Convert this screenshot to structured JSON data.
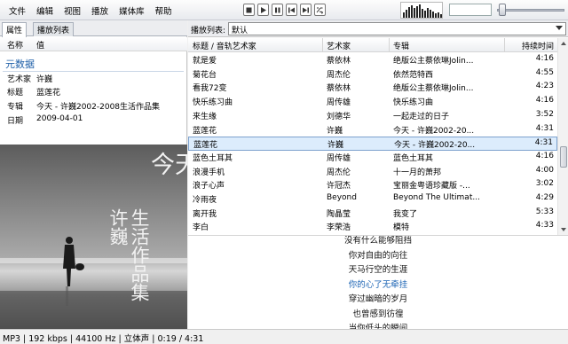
{
  "menu": [
    "文件",
    "编辑",
    "视图",
    "播放",
    "媒体库",
    "帮助"
  ],
  "left": {
    "tabs": [
      "属性",
      "播放列表"
    ],
    "columns": {
      "name": "名称",
      "value": "值"
    },
    "metadata_title": "元数据",
    "properties": [
      {
        "key": "艺术家",
        "value": "许巍"
      },
      {
        "key": "标题",
        "value": "蓝莲花"
      },
      {
        "key": "专辑",
        "value": "今天 - 许巍2002-2008生活作品集"
      },
      {
        "key": "日期",
        "value": "2009-04-01"
      }
    ],
    "cover": {
      "line1": "今天。",
      "line2": "许巍",
      "line3": "生活作品集"
    }
  },
  "playlist": {
    "label": "播放列表:",
    "selected": "默认",
    "columns": {
      "title": "标题 / 音轨艺术家",
      "artist": "艺术家",
      "album": "专辑",
      "duration": "持续时间"
    },
    "rows": [
      {
        "title": "就是爱",
        "artist": "蔡依林",
        "album": "绝版公主蔡依琳Jolin...",
        "duration": "4:16"
      },
      {
        "title": "菊花台",
        "artist": "周杰伦",
        "album": "依然范特西",
        "duration": "4:55"
      },
      {
        "title": "看我72变",
        "artist": "蔡依林",
        "album": "绝版公主蔡依琳Jolin...",
        "duration": "4:23"
      },
      {
        "title": "快乐练习曲",
        "artist": "周传雄",
        "album": "快乐练习曲",
        "duration": "4:16"
      },
      {
        "title": "来生缘",
        "artist": "刘德华",
        "album": "一起走过的日子",
        "duration": "3:52"
      },
      {
        "title": "蓝莲花",
        "artist": "许巍",
        "album": "今天 - 许巍2002-20...",
        "duration": "4:31"
      },
      {
        "title": "蓝莲花",
        "artist": "许巍",
        "album": "今天 - 许巍2002-20...",
        "duration": "4:31"
      },
      {
        "title": "蓝色土耳其",
        "artist": "周传雄",
        "album": "蓝色土耳其",
        "duration": "4:16"
      },
      {
        "title": "浪漫手机",
        "artist": "周杰伦",
        "album": "十一月的萧邦",
        "duration": "4:00"
      },
      {
        "title": "浪子心声",
        "artist": "许冠杰",
        "album": "宝丽金粤语珍藏版 -...",
        "duration": "3:02"
      },
      {
        "title": "冷雨夜",
        "artist": "Beyond",
        "album": "Beyond The Ultimat...",
        "duration": "4:29"
      },
      {
        "title": "离开我",
        "artist": "陶晶莹",
        "album": "我变了",
        "duration": "5:33"
      },
      {
        "title": "李白",
        "artist": "李荣浩",
        "album": "模特",
        "duration": "4:33"
      }
    ],
    "selected_index": 6
  },
  "lyrics": {
    "lines": [
      "没有什么能够阻挡",
      "你对自由的向往",
      "天马行空的生涯",
      "你的心了无牵挂",
      "穿过幽暗的岁月",
      "也曾感到彷徨",
      "当你低头的瞬间"
    ],
    "current_index": 3
  },
  "status": "MP3 | 192 kbps | 44100 Hz | 立体声 | 0:19 / 4:31"
}
